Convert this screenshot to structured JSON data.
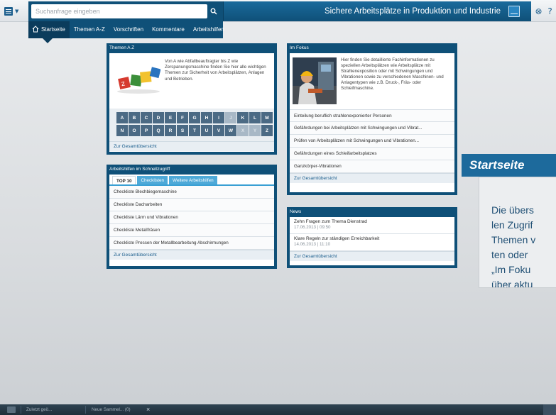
{
  "search": {
    "placeholder": "Suchanfrage eingeben"
  },
  "header": {
    "title": "Sichere Arbeitsplätze in Produktion und Industrie"
  },
  "nav": {
    "items": [
      {
        "label": "Startseite"
      },
      {
        "label": "Themen A-Z"
      },
      {
        "label": "Vorschriften"
      },
      {
        "label": "Kommentare"
      },
      {
        "label": "Arbeitshilfen"
      }
    ]
  },
  "themen": {
    "heading": "Themen A Z",
    "text": "Von A wie Abfallbeauftragter bis Z wie Zerspanungsmaschine finden Sie hier alle wichtigen Themen zur Sicherheit von Arbeitsplätzen, Anlagen und Betrieben.",
    "letters": [
      "A",
      "B",
      "C",
      "D",
      "E",
      "F",
      "G",
      "H",
      "I",
      "J",
      "K",
      "L",
      "M",
      "N",
      "O",
      "P",
      "Q",
      "R",
      "S",
      "T",
      "U",
      "V",
      "W",
      "X",
      "Y",
      "Z"
    ],
    "disabled_letters": [
      "J",
      "X",
      "Y"
    ],
    "link": "Zur Gesamtübersicht"
  },
  "fokus": {
    "heading": "Im Fokus",
    "text": "Hier finden Sie detaillierte Fachinformationen zu speziellen Arbeitsplätzen wie Arbeitsplätze mit Strahlenexposition oder mit Schwingungen und Vibrationen sowie zu verschiedenen Maschinen- und Anlagentypen wie z.B. Druck-, Fräs- oder Schleifmaschine.",
    "items": [
      {
        "label": "Einteilung beruflich strahlenexponierter Personen"
      },
      {
        "label": "Gefährdungen bei Arbeitsplätzen mit Schwingungen und Vibrat..."
      },
      {
        "label": "Prüfen von Arbeitsplätzen mit Schwingungen und Vibrationen..."
      },
      {
        "label": "Gefährdungen eines Schleifarbeitsplatzes"
      },
      {
        "label": "Ganzkörper-Vibrationen"
      }
    ],
    "link": "Zur Gesamtübersicht"
  },
  "arbeitshilfen": {
    "heading": "Arbeitshilfen im Schnellzugriff",
    "tabs": [
      {
        "label": "TOP 10"
      },
      {
        "label": "Checklisten"
      },
      {
        "label": "Weitere Arbeitshilfen"
      }
    ],
    "items": [
      {
        "label": "Checkliste Blechbiegemaschine"
      },
      {
        "label": "Checkliste Dacharbeiten"
      },
      {
        "label": "Checkliste Lärm und Vibrationen"
      },
      {
        "label": "Checkliste Metallfräsen"
      },
      {
        "label": "Checkliste Pressen der Metallbearbeitung Abschirmungen"
      }
    ],
    "link": "Zur Gesamtübersicht"
  },
  "news": {
    "heading": "News",
    "items": [
      {
        "title": "Zehn Fragen zum Thema Dienstrad",
        "date": "17.06.2013 | 09:50"
      },
      {
        "title": "Klare Regeln zur ständigen Erreichbarkeit",
        "date": "14.06.2013 | 11:10"
      }
    ],
    "link": "Zur Gesamtübersicht"
  },
  "startseite": {
    "title": "Startseite",
    "lines": [
      "Die übers",
      "len Zugrif",
      "Themen v",
      "ten oder",
      "„Im Foku",
      "über aktu"
    ]
  },
  "bottombar": {
    "recent": "Zuletzt geö...",
    "collection": "Neue Sammel... (0)",
    "close": "×"
  },
  "colors": {
    "primary": "#0f5078",
    "nav_active": "#0b3c5c",
    "tab_blue": "#4ea9d8",
    "link": "#1a5d8c"
  }
}
